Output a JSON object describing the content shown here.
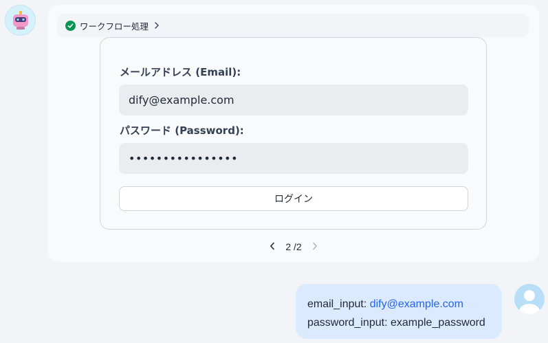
{
  "workflow": {
    "label": "ワークフロー処理"
  },
  "form": {
    "email_label": "メールアドレス (Email):",
    "email_value": "dify@example.com",
    "password_label": "パスワード (Password):",
    "password_dots": "••••••••••••••••",
    "login_button": "ログイン"
  },
  "pagination": {
    "current": "2",
    "total": "/2"
  },
  "user_message": {
    "email_prefix": "email_input: ",
    "email_value": "dify@example.com",
    "password_line": "password_input: example_password"
  },
  "colors": {
    "success": "#079455",
    "link": "#2563eb",
    "user_bubble": "#dbeafe"
  }
}
